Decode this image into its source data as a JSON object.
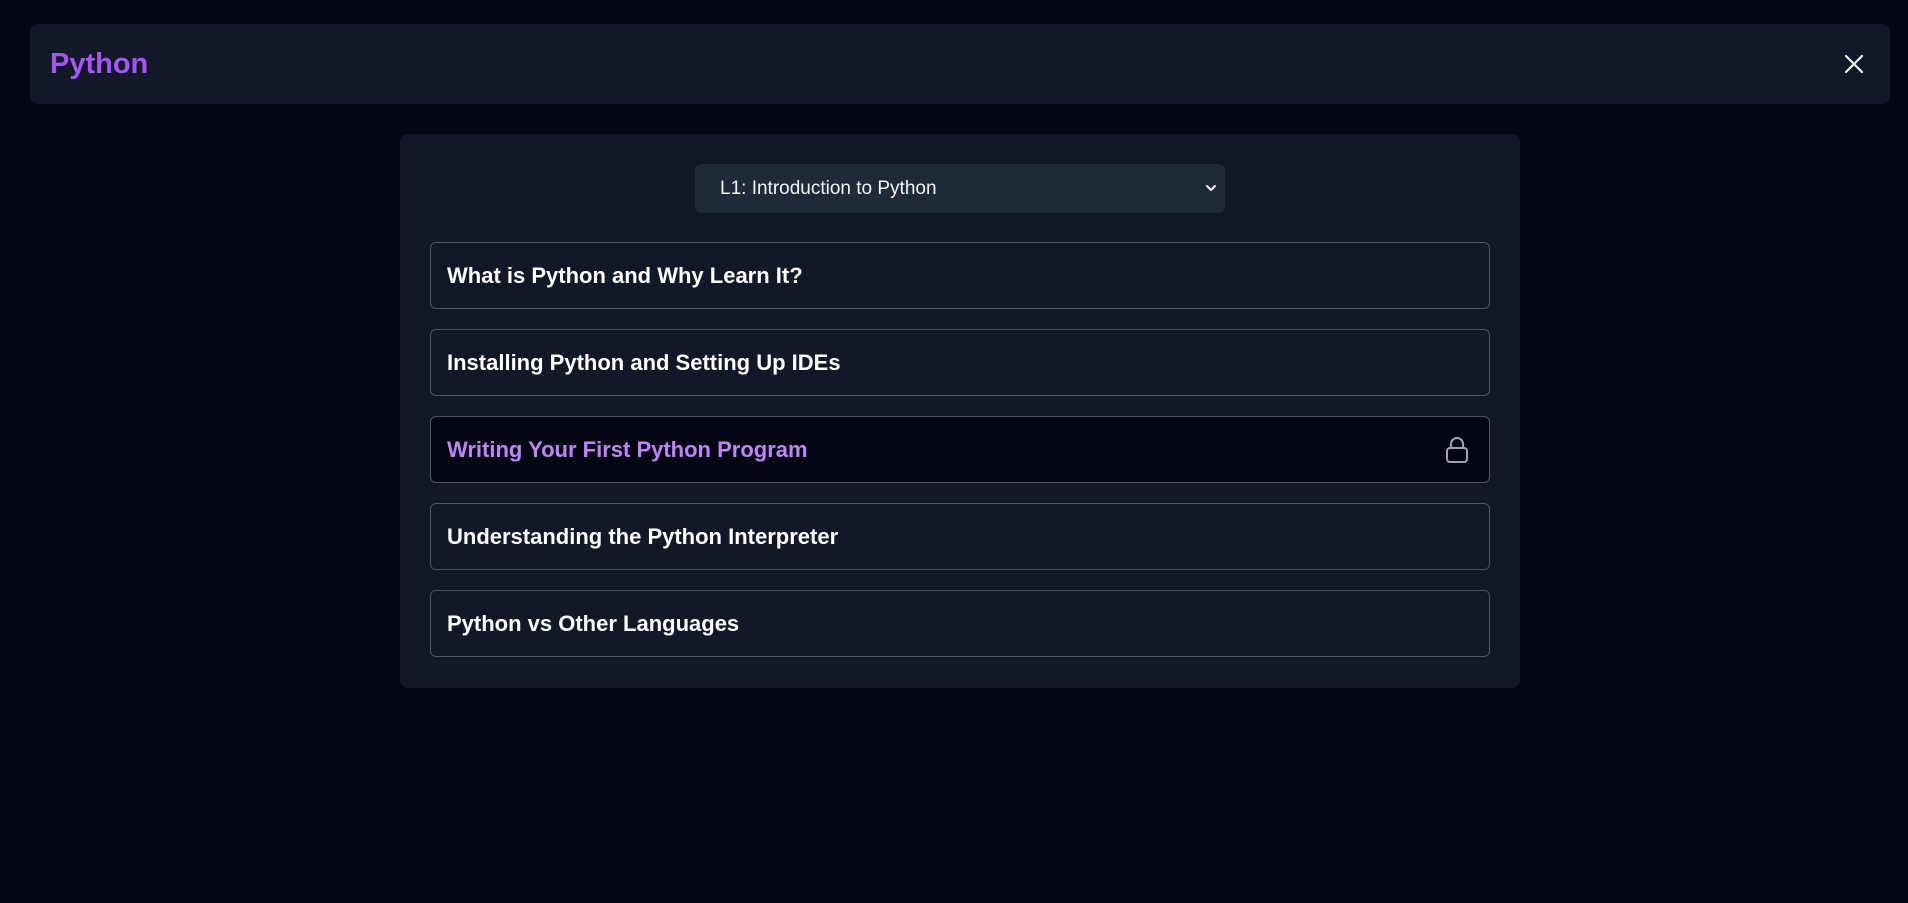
{
  "header": {
    "title": "Python",
    "close_icon": "close-icon"
  },
  "module_select": {
    "selected": "L1: Introduction to Python",
    "icon": "chevron-down-icon"
  },
  "lessons": [
    {
      "label": "What is Python and Why Learn It?",
      "active": false
    },
    {
      "label": "Installing Python and Setting Up IDEs",
      "active": false
    },
    {
      "label": "Writing Your First Python Program",
      "active": true,
      "icon": "lock-icon"
    },
    {
      "label": "Understanding the Python Interpreter",
      "active": false
    },
    {
      "label": "Python vs Other Languages",
      "active": false
    }
  ],
  "colors": {
    "background": "#030712",
    "surface": "#111827",
    "accent": "#a855f7",
    "active_text": "#c084fc"
  }
}
